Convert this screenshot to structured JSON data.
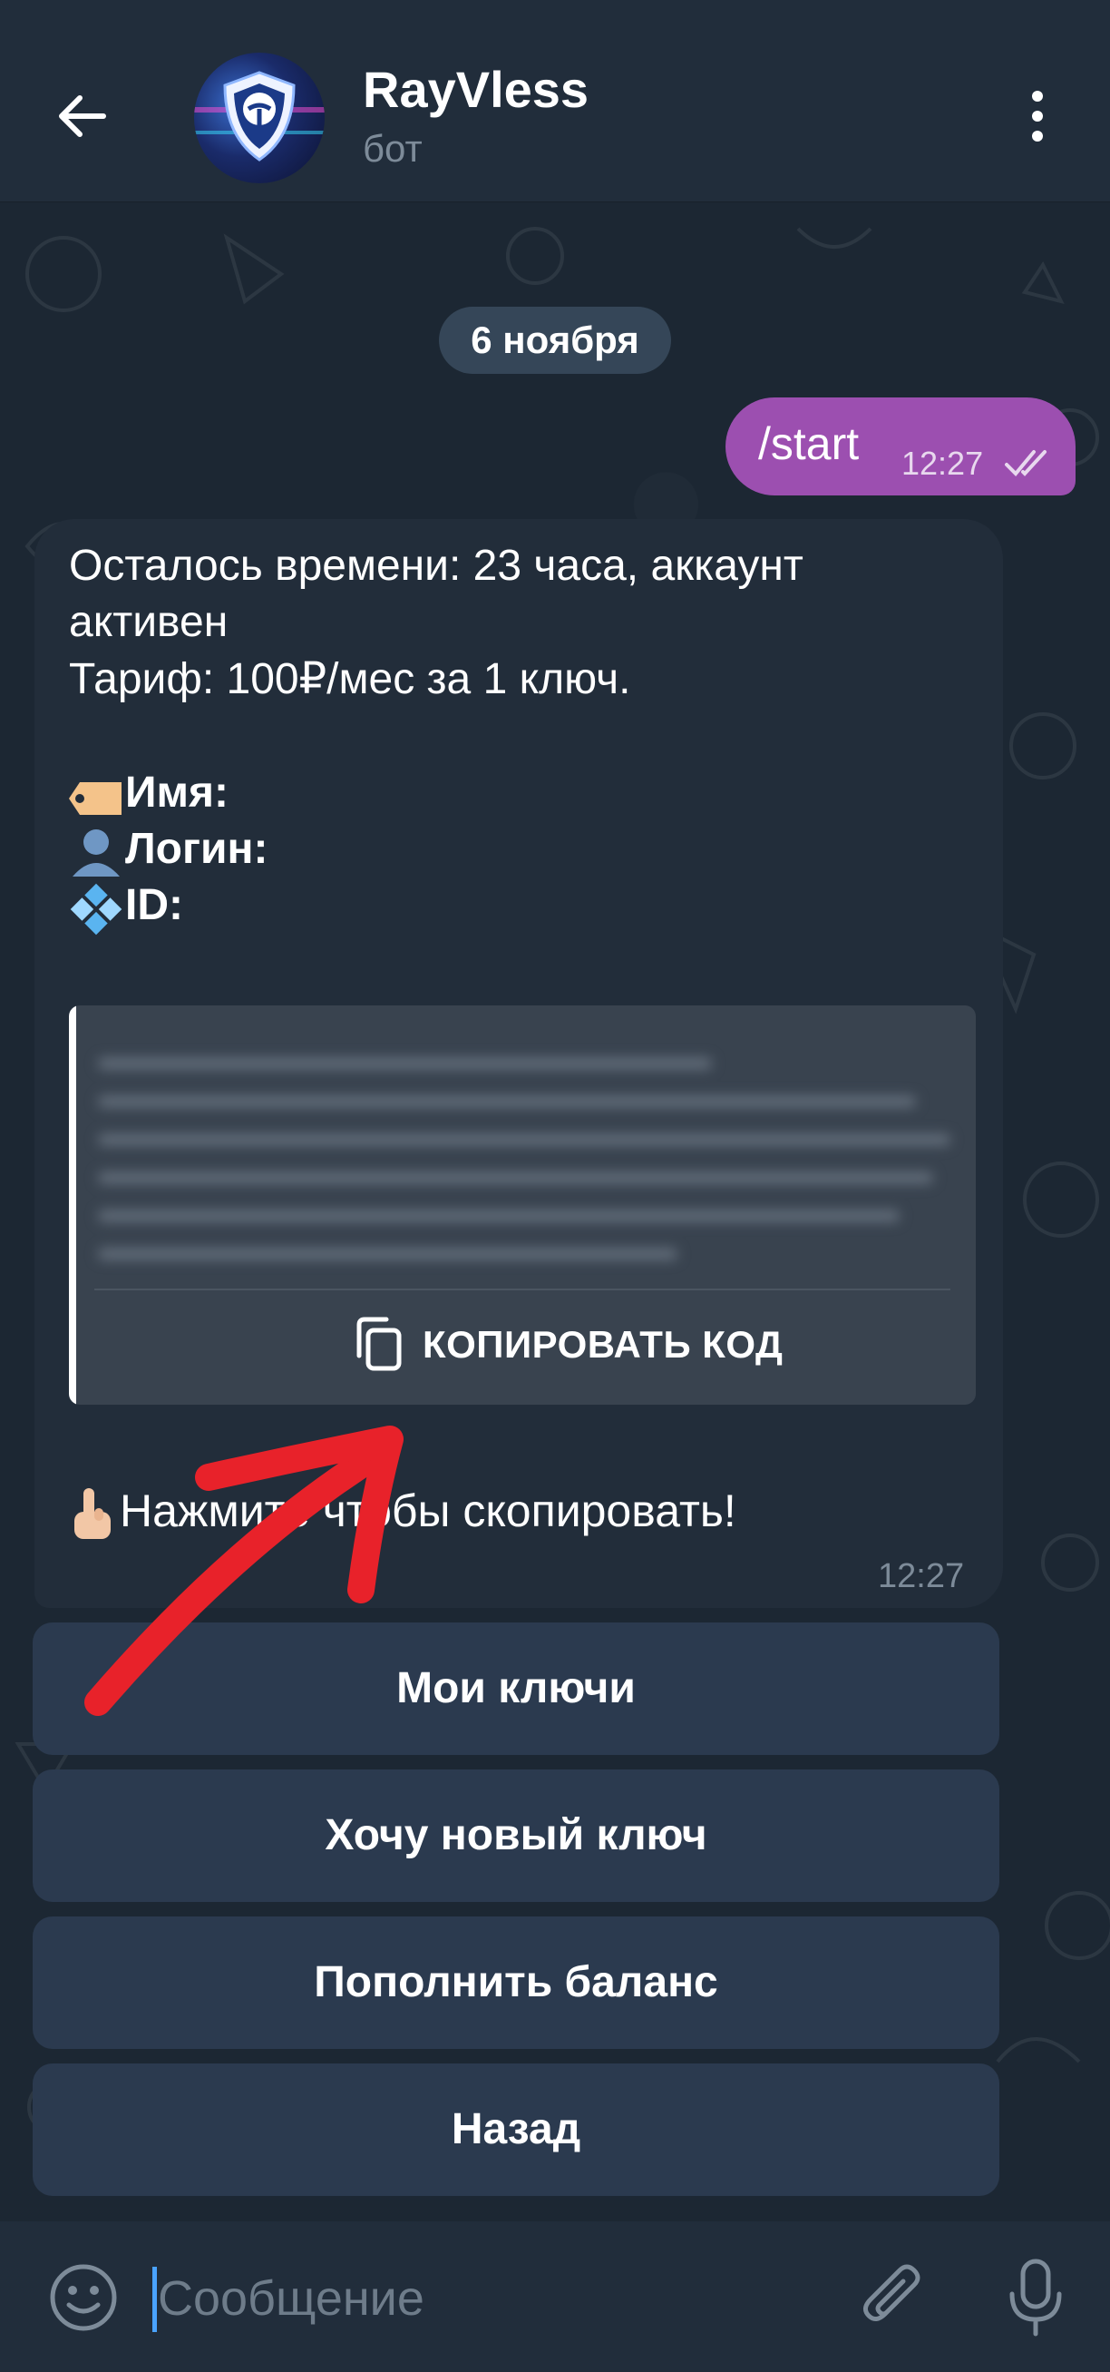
{
  "header": {
    "title": "RayVless",
    "subtitle": "бот"
  },
  "chat": {
    "date_label": "6 ноября",
    "outgoing": {
      "text": "/start",
      "time": "12:27",
      "status": "read"
    },
    "incoming": {
      "lines": [
        "Осталось времени: 23 часа, аккаунт",
        "активен",
        "Тариф: 100₽/мес за 1 ключ."
      ],
      "fields": [
        {
          "emoji": "label-tag-icon",
          "label": "Имя:"
        },
        {
          "emoji": "person-silhouette-icon",
          "label": "Логин:"
        },
        {
          "emoji": "diamond-tiles-icon",
          "label": "ID:"
        }
      ],
      "copy_button": "КОПИРОВАТЬ КОД",
      "tap_hint": "Нажмите чтобы скопировать!",
      "time": "12:27"
    }
  },
  "keyboard": {
    "buttons": [
      "Мои ключи",
      "Хочу новый ключ",
      "Пополнить баланс",
      "Назад"
    ]
  },
  "composer": {
    "placeholder": "Сообщение"
  },
  "colors": {
    "header_bg": "#212d3b",
    "outgoing_bubble": "#9c4fb0",
    "incoming_bubble": "#222d3a",
    "keyboard_button": "#2b3a4f",
    "annotation": "#e8222a"
  }
}
